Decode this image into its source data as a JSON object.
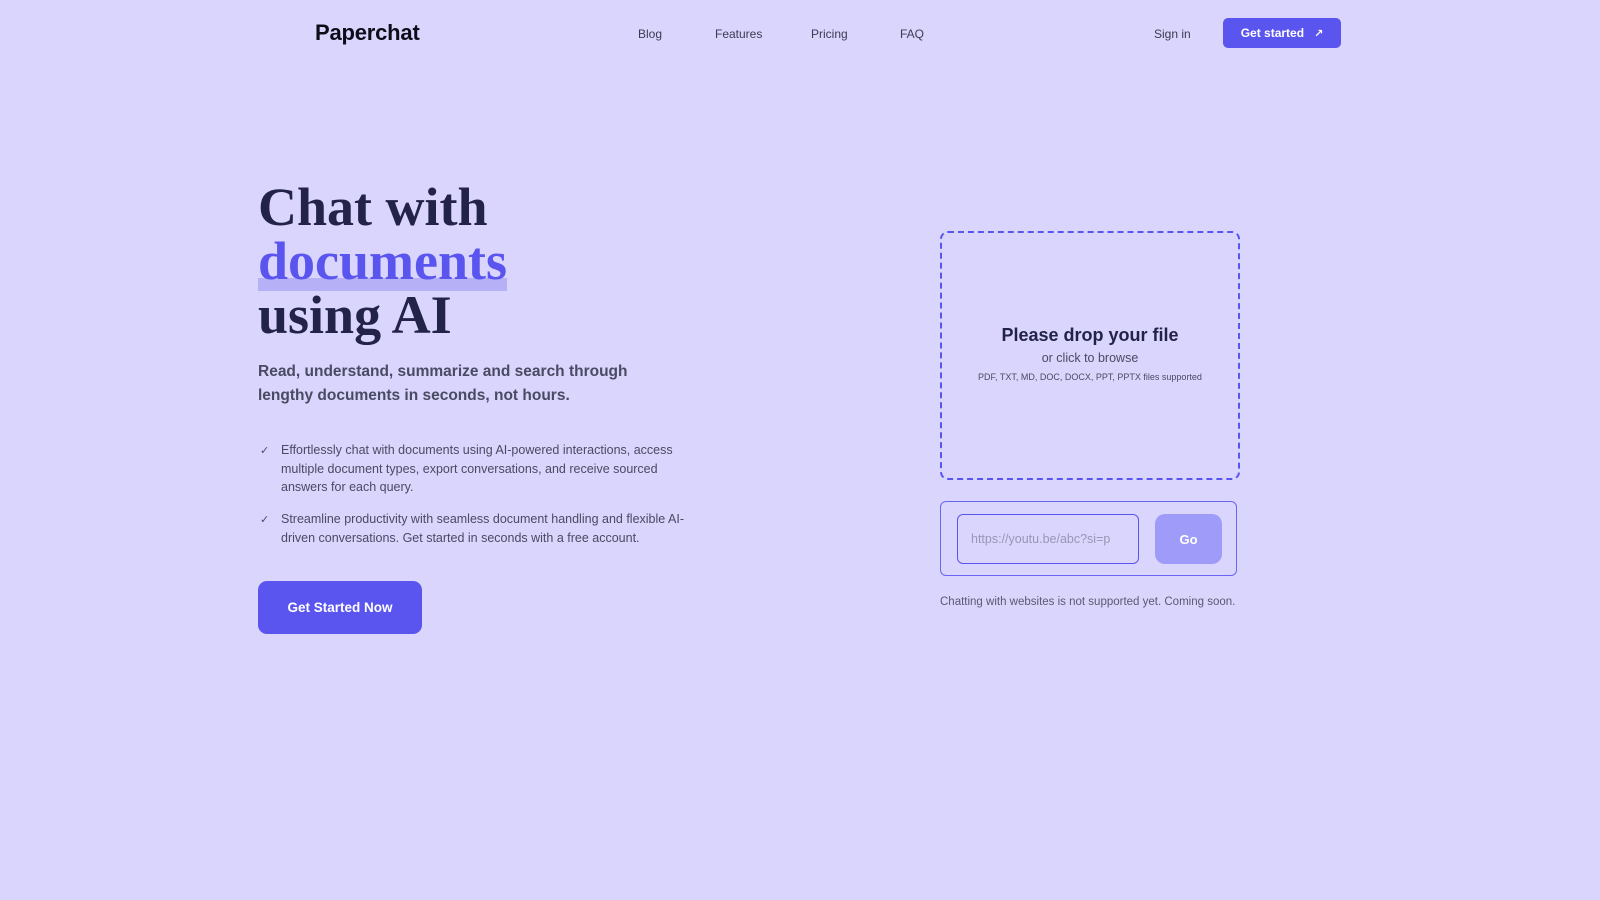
{
  "header": {
    "logo": "Paperchat",
    "nav": [
      "Blog",
      "Features",
      "Pricing",
      "FAQ"
    ],
    "sign_in": "Sign in",
    "get_started": "Get started",
    "get_started_icon": "arrow-up-right-icon"
  },
  "hero": {
    "title_line1": "Chat with",
    "title_accent": "documents",
    "title_line3": "using AI",
    "subtitle": "Read, understand, summarize and search through lengthy documents in seconds, not hours.",
    "bullets": [
      "Effortlessly chat with documents using AI-powered interactions, access multiple document types, export conversations, and receive sourced answers for each query.",
      "Streamline productivity with seamless document handling and flexible AI-driven conversations. Get started in seconds with a free account."
    ],
    "check_glyph": "✓",
    "cta": "Get Started Now"
  },
  "upload": {
    "title": "Please drop your file",
    "subtitle": "or click to browse",
    "types": "PDF, TXT, MD, DOC, DOCX, PPT, PPTX files supported",
    "url_placeholder": "https://youtu.be/abc?si=p",
    "go": "Go",
    "note": "Chatting with websites is not supported yet. Coming soon."
  },
  "colors": {
    "background": "#d9d5fc",
    "accent": "#5b55f0",
    "go_button": "#9f9bf8",
    "heading": "#23234a"
  }
}
